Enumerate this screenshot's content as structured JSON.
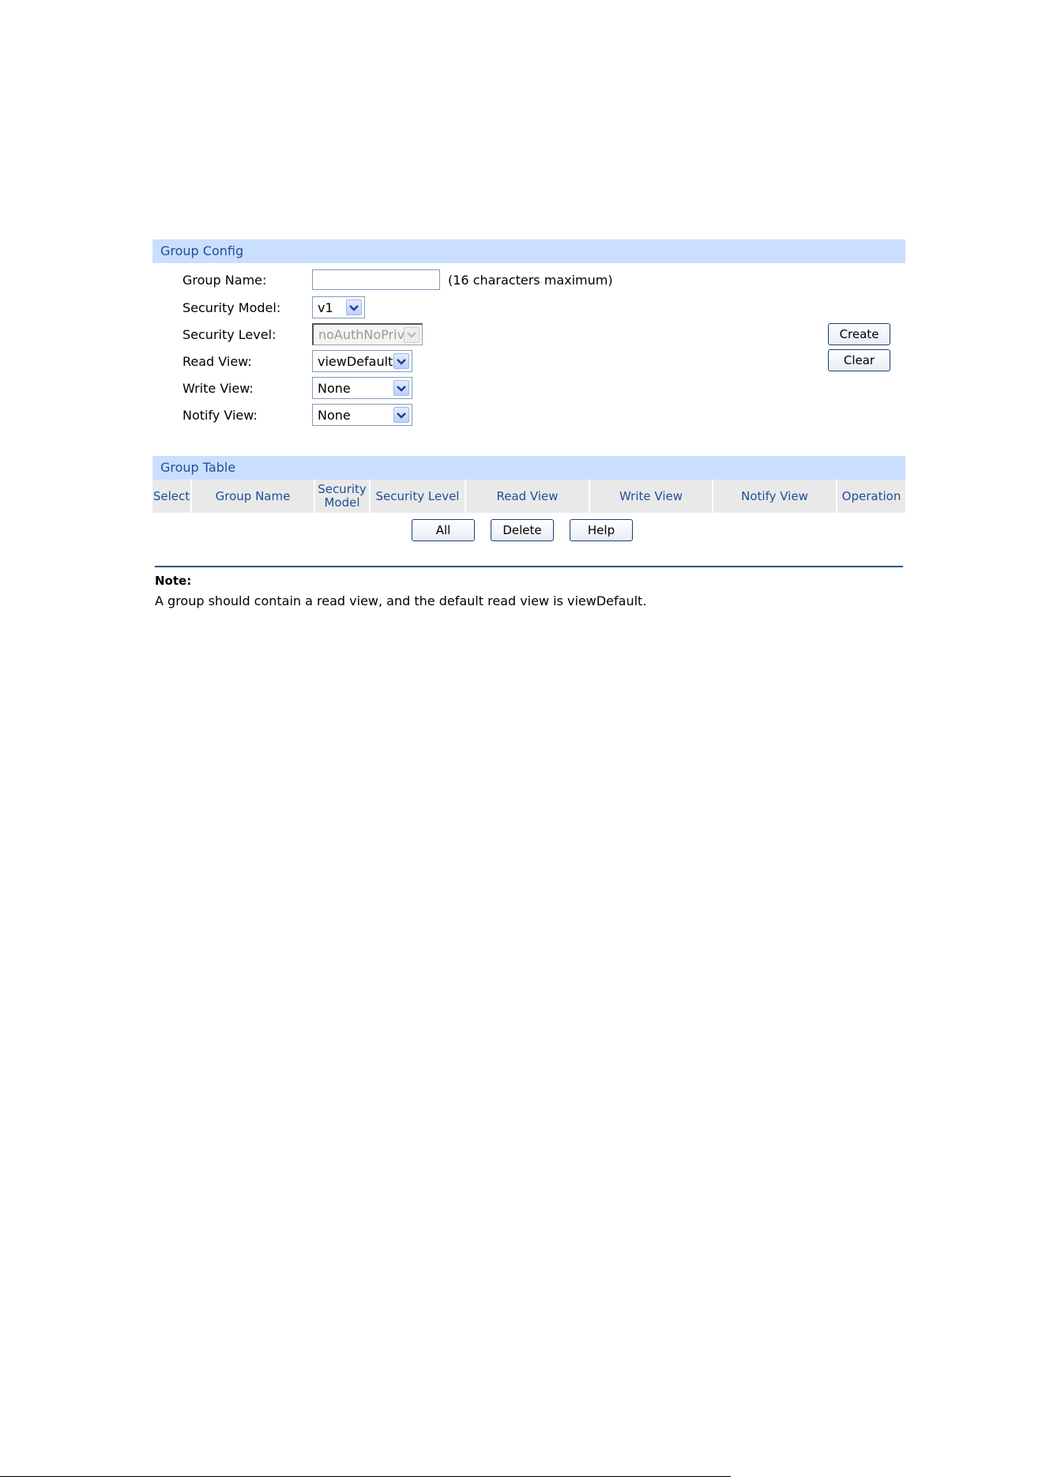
{
  "group_config": {
    "header": "Group Config",
    "group_name": {
      "label": "Group Name:",
      "value": "",
      "hint": "(16 characters maximum)"
    },
    "security_model": {
      "label": "Security Model:",
      "value": "v1"
    },
    "security_level": {
      "label": "Security Level:",
      "value": "noAuthNoPriv"
    },
    "read_view": {
      "label": "Read View:",
      "value": "viewDefault"
    },
    "write_view": {
      "label": "Write View:",
      "value": "None"
    },
    "notify_view": {
      "label": "Notify View:",
      "value": "None"
    },
    "create_label": "Create",
    "clear_label": "Clear"
  },
  "group_table": {
    "header": "Group Table",
    "columns": {
      "select": "Select",
      "group_name": "Group Name",
      "security_model_line1": "Security",
      "security_model_line2": "Model",
      "security_level": "Security Level",
      "read_view": "Read View",
      "write_view": "Write View",
      "notify_view": "Notify View",
      "operation": "Operation"
    },
    "all_label": "All",
    "delete_label": "Delete",
    "help_label": "Help"
  },
  "note": {
    "title": "Note:",
    "text": "A group should contain a read view, and the default read view is viewDefault."
  }
}
